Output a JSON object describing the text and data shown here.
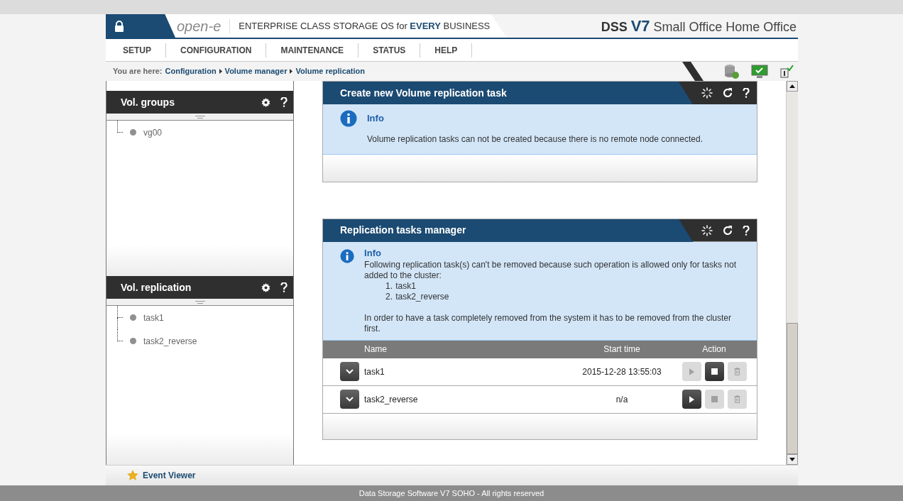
{
  "header": {
    "logo": "open-e",
    "tagline_parts": [
      {
        "text": "ENTERPRISE CLASS STORAGE OS for ",
        "bold": false
      },
      {
        "text": "EVERY",
        "bold": true
      },
      {
        "text": " BUSINESS",
        "bold": false
      }
    ],
    "product": {
      "prefix": "DSS",
      "version": "V7",
      "edition": "Small Office Home Office"
    }
  },
  "nav": [
    {
      "label": "SETUP"
    },
    {
      "label": "CONFIGURATION"
    },
    {
      "label": "MAINTENANCE"
    },
    {
      "label": "STATUS"
    },
    {
      "label": "HELP"
    }
  ],
  "breadcrumb": {
    "prefix": "You are here:",
    "items": [
      "Configuration",
      "Volume manager",
      "Volume replication"
    ]
  },
  "sidebar": [
    {
      "title": "Vol. groups",
      "items": [
        {
          "label": "vg00"
        }
      ]
    },
    {
      "title": "Vol. replication",
      "items": [
        {
          "label": "task1"
        },
        {
          "label": "task2_reverse"
        }
      ]
    }
  ],
  "create_panel": {
    "title": "Create new Volume replication task",
    "info_title": "Info",
    "info_text": "Volume replication tasks can not be created because there is no remote node connected."
  },
  "manager_panel": {
    "title": "Replication tasks manager",
    "info_title": "Info",
    "info_text": "Following replication task(s) can't be removed because such operation is allowed only for tasks not added to the cluster:",
    "info_list": [
      {
        "number": "1.",
        "text": "task1"
      },
      {
        "number": "2.",
        "text": "task2_reverse"
      }
    ],
    "info_note": "In order to have a task completely removed from the system it has to be removed from the cluster first.",
    "columns": [
      "Name",
      "Start time",
      "Action"
    ],
    "rows": [
      {
        "name": "task1",
        "start_time": "2015-12-28 13:55:03",
        "actions": [
          {
            "kind": "play",
            "disabled": true
          },
          {
            "kind": "stop",
            "disabled": false
          },
          {
            "kind": "delete",
            "disabled": true
          }
        ]
      },
      {
        "name": "task2_reverse",
        "start_time": "n/a",
        "actions": [
          {
            "kind": "play",
            "disabled": false
          },
          {
            "kind": "stop",
            "disabled": true
          },
          {
            "kind": "delete",
            "disabled": true
          }
        ]
      }
    ]
  },
  "event_viewer": "Event Viewer",
  "footer": "Data Storage Software V7 SOHO - All rights reserved"
}
